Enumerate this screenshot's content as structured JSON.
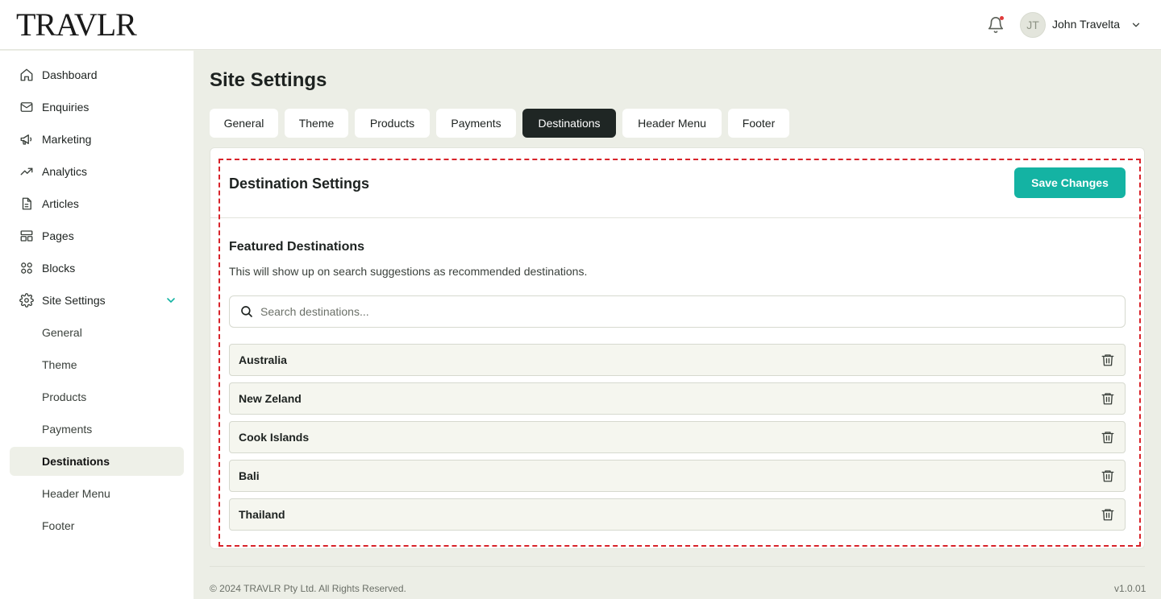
{
  "header": {
    "logo": "TRAVLR",
    "user": {
      "initials": "JT",
      "name": "John Travelta"
    },
    "icons": {
      "notification": "bell-icon",
      "user_menu": "chevron-down-icon"
    },
    "notification_dot_color": "#e03a3a"
  },
  "sidebar": {
    "items": [
      {
        "label": "Dashboard",
        "icon": "home-icon"
      },
      {
        "label": "Enquiries",
        "icon": "mail-icon"
      },
      {
        "label": "Marketing",
        "icon": "megaphone-icon"
      },
      {
        "label": "Analytics",
        "icon": "trending-up-icon"
      },
      {
        "label": "Articles",
        "icon": "file-icon"
      },
      {
        "label": "Pages",
        "icon": "layout-icon"
      },
      {
        "label": "Blocks",
        "icon": "grid-icon"
      },
      {
        "label": "Site Settings",
        "icon": "gear-icon",
        "expanded": true
      }
    ],
    "sub_items": [
      "General",
      "Theme",
      "Products",
      "Payments",
      "Destinations",
      "Header Menu",
      "Footer"
    ],
    "active_sub_item": "Destinations"
  },
  "main": {
    "title": "Site Settings",
    "tabs": [
      "General",
      "Theme",
      "Products",
      "Payments",
      "Destinations",
      "Header Menu",
      "Footer"
    ],
    "active_tab": "Destinations",
    "card": {
      "title": "Destination Settings",
      "save_label": "Save Changes",
      "section_title": "Featured Destinations",
      "section_desc": "This will show up on search suggestions as recommended destinations.",
      "search": {
        "placeholder": "Search destinations...",
        "value": ""
      },
      "destinations": [
        "Australia",
        "New Zeland",
        "Cook Islands",
        "Bali",
        "Thailand"
      ],
      "row_icon": "trash-icon"
    }
  },
  "footer": {
    "copyright": "© 2024 TRAVLR Pty Ltd. All Rights Reserved.",
    "version": "v1.0.01"
  },
  "colors": {
    "accent": "#14b3a3",
    "active_tab": "#1f2624",
    "highlight_border": "#d8232a",
    "page_bg": "#eceee6"
  }
}
